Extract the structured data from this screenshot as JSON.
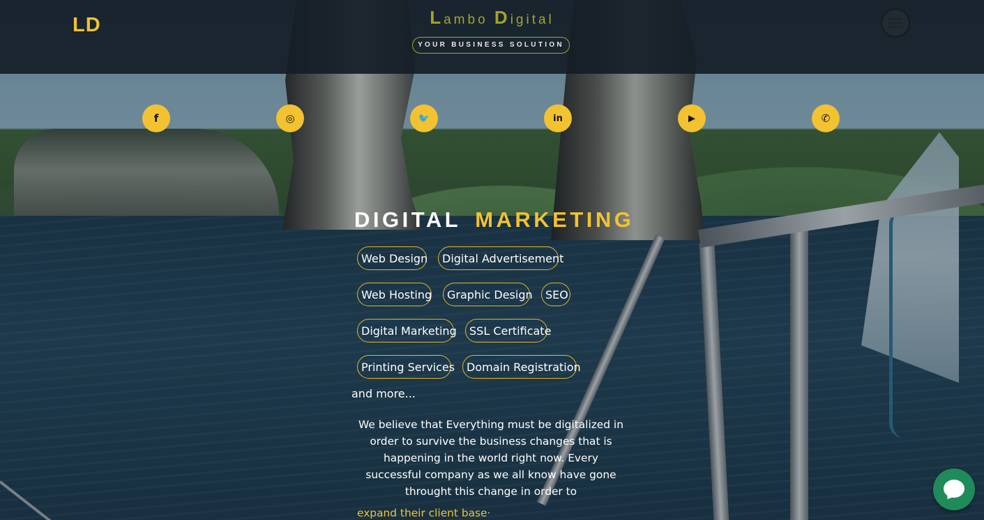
{
  "header": {
    "logo": "LD",
    "brand_first_initial": "L",
    "brand_first_rest": "ambo",
    "brand_second_initial": "D",
    "brand_second_rest": "igital",
    "tagline": "YOUR BUSINESS SOLUTION",
    "menu_icon": "hamburger-menu-icon"
  },
  "social_links": [
    {
      "icon": "facebook-icon",
      "glyph": "f"
    },
    {
      "icon": "instagram-icon",
      "glyph": "◎"
    },
    {
      "icon": "twitter-icon",
      "glyph": "🐦"
    },
    {
      "icon": "linkedin-icon",
      "glyph": "in"
    },
    {
      "icon": "youtube-icon",
      "glyph": "▶"
    },
    {
      "icon": "whatsapp-icon",
      "glyph": "✆"
    }
  ],
  "hero": {
    "title_white": "DIGITAL",
    "title_yellow": "MARKETING",
    "services": [
      "Web Design",
      "Digital Advertisement",
      "Web Hosting",
      "Graphic Design",
      "SEO",
      "Digital Marketing",
      "SSL Certificate",
      "Printing Services",
      "Domain Registration"
    ],
    "more": "and more...",
    "paragraph": "We believe that Everything must be digitalized in order to survive the business changes that is happening in the world right now. Every successful company as we all know have gone throught this change in order to",
    "rotating_text": "expand their client base",
    "cursor": "·"
  },
  "colors": {
    "accent": "#f2c230",
    "brand_olive": "#a6a428",
    "header_bg": "#141e28",
    "chat_green": "#1f8a5a"
  },
  "chat": {
    "icon": "chat-bubble-icon"
  }
}
